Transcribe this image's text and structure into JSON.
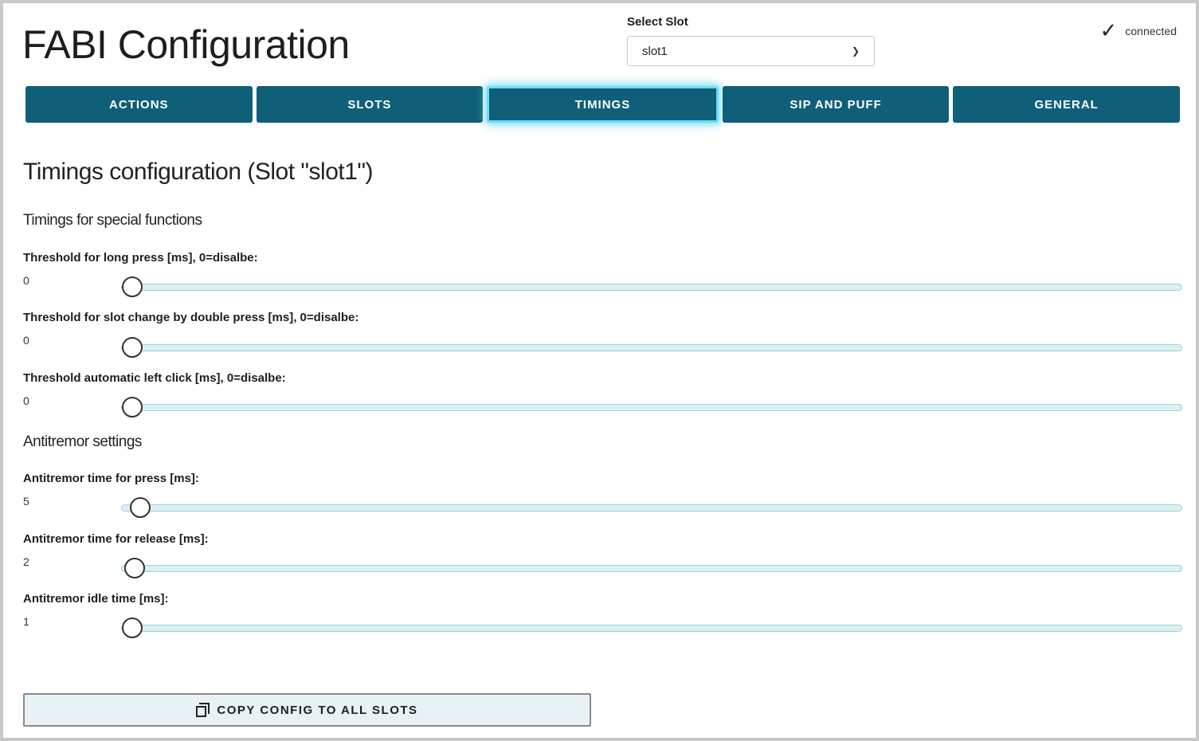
{
  "header": {
    "title": "FABI Configuration",
    "slot_label": "Select Slot",
    "slot_selected": "slot1",
    "connection_status": "connected"
  },
  "tabs": [
    {
      "label": "ACTIONS",
      "active": false
    },
    {
      "label": "SLOTS",
      "active": false
    },
    {
      "label": "TIMINGS",
      "active": true
    },
    {
      "label": "SIP AND PUFF",
      "active": false
    },
    {
      "label": "GENERAL",
      "active": false
    }
  ],
  "main": {
    "title": "Timings configuration (Slot \"slot1\")",
    "sections": [
      {
        "heading": "Timings for special functions",
        "fields": [
          {
            "label": "Threshold for long press [ms], 0=disalbe:",
            "value": "0",
            "fraction": 0.0
          },
          {
            "label": "Threshold for slot change by double press [ms], 0=disalbe:",
            "value": "0",
            "fraction": 0.0
          },
          {
            "label": "Threshold automatic left click [ms], 0=disalbe:",
            "value": "0",
            "fraction": 0.0
          }
        ]
      },
      {
        "heading": "Antitremor settings",
        "fields": [
          {
            "label": "Antitremor time for press [ms]:",
            "value": "5",
            "fraction": 0.0075
          },
          {
            "label": "Antitremor time for release [ms]:",
            "value": "2",
            "fraction": 0.002
          },
          {
            "label": "Antitremor idle time [ms]:",
            "value": "1",
            "fraction": 0.0
          }
        ]
      }
    ],
    "copy_button": "COPY CONFIG TO ALL SLOTS"
  },
  "colors": {
    "tab_bg": "#0f5f78",
    "tab_active_glow": "#6fdcf7",
    "slider_track": "#d7f1f4"
  }
}
